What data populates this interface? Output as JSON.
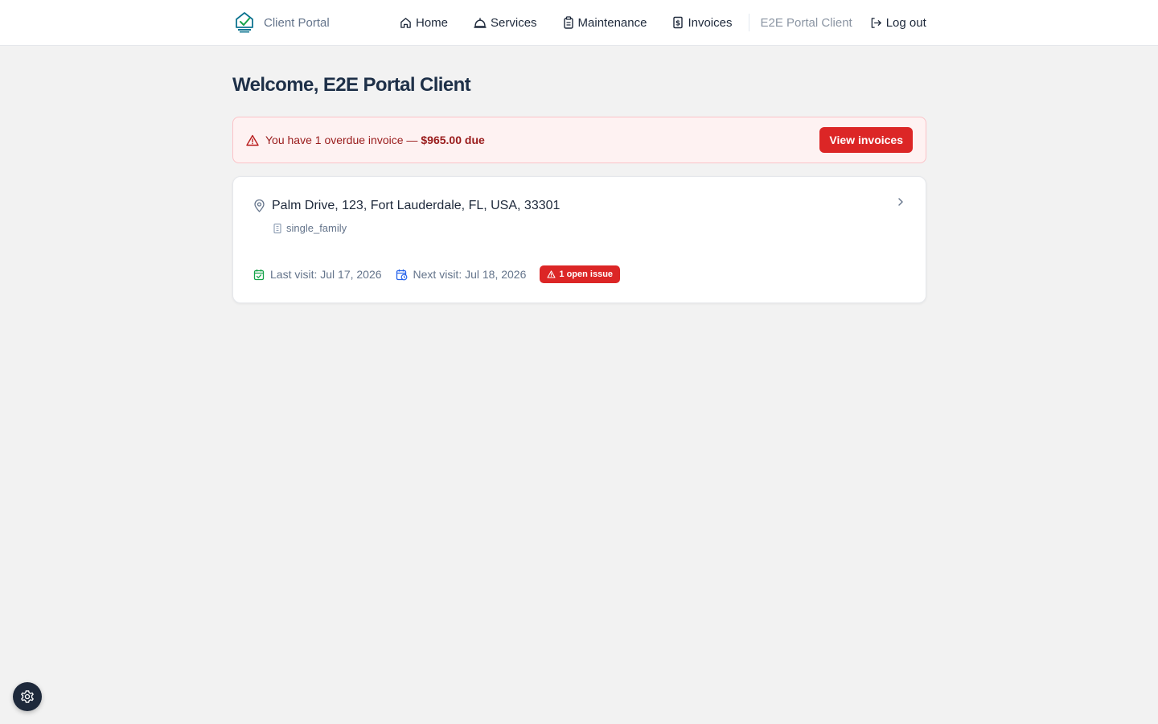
{
  "header": {
    "brand_name": "Client Portal",
    "logo_icon": "home-logo-icon",
    "nav": [
      {
        "label": "Home",
        "icon": "home-icon"
      },
      {
        "label": "Services",
        "icon": "bell-service-icon"
      },
      {
        "label": "Maintenance",
        "icon": "clipboard-icon"
      },
      {
        "label": "Invoices",
        "icon": "invoice-icon"
      }
    ],
    "user_name": "E2E Portal Client",
    "logout_label": "Log out"
  },
  "page": {
    "title": "Welcome, E2E Portal Client"
  },
  "alert": {
    "text": "You have 1 overdue invoice —",
    "amount": "$965.00 due",
    "button_label": "View invoices"
  },
  "property": {
    "address": "Palm Drive, 123, Fort Lauderdale, FL, USA, 33301",
    "type": "single_family",
    "last_visit": "Last visit: Jul 17, 2026",
    "next_visit": "Next visit: Jul 18, 2026",
    "issue_badge": "1 open issue"
  },
  "colors": {
    "accent_danger": "#dc2626",
    "alert_bg": "#fef2f2",
    "heading": "#1e3048",
    "last_visit_icon": "#16a34a",
    "next_visit_icon": "#2563eb"
  }
}
